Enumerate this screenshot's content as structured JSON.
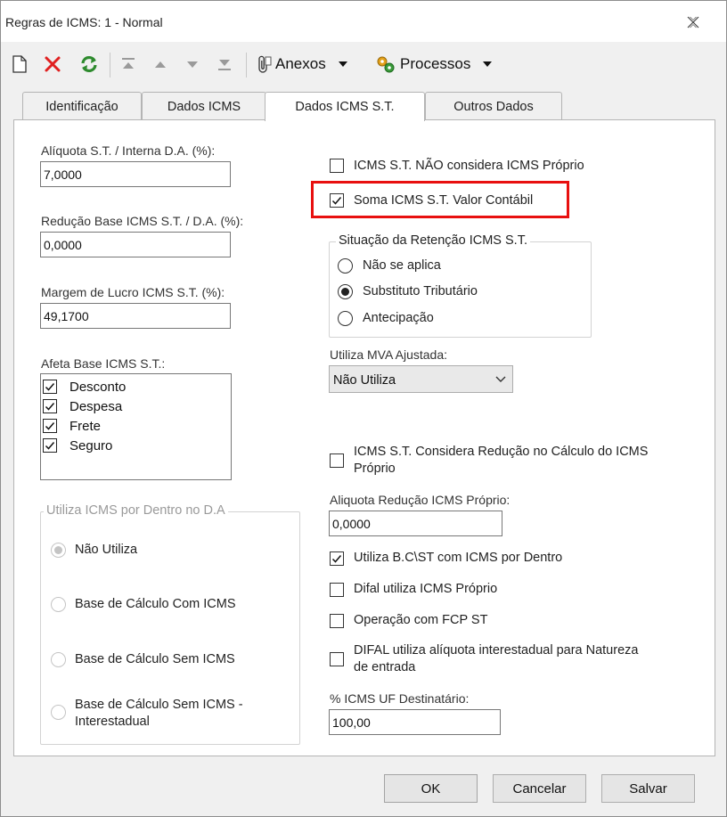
{
  "window": {
    "title": "Regras de ICMS: 1 - Normal"
  },
  "toolbar": {
    "icons": [
      "new-document-icon",
      "delete-x-icon",
      "refresh-icon",
      "move-first-icon",
      "move-up-icon",
      "move-down-icon",
      "move-last-icon",
      "paperclip-icon",
      "gears-icon"
    ],
    "anexos_label": "Anexos",
    "processos_label": "Processos"
  },
  "tabs": [
    {
      "label": "Identificação",
      "active": false
    },
    {
      "label": "Dados ICMS",
      "active": false
    },
    {
      "label": "Dados ICMS S.T.",
      "active": true
    },
    {
      "label": "Outros Dados",
      "active": false
    }
  ],
  "left": {
    "aliquota_label": "Alíquota S.T. / Interna D.A. (%):",
    "aliquota_value": "7,0000",
    "reducao_label": "Redução Base ICMS S.T. / D.A. (%):",
    "reducao_value": "0,0000",
    "margem_label": "Margem de Lucro ICMS S.T. (%):",
    "margem_value": "49,1700",
    "afeta_label": "Afeta Base ICMS S.T.:",
    "afeta_items": [
      {
        "label": "Desconto",
        "checked": true
      },
      {
        "label": "Despesa",
        "checked": true
      },
      {
        "label": "Frete",
        "checked": true
      },
      {
        "label": "Seguro",
        "checked": true
      }
    ],
    "icms_dentro_group": {
      "title": "Utiliza ICMS por Dentro no D.A",
      "options": [
        {
          "label": "Não Utiliza",
          "selected": true
        },
        {
          "label": "Base de Cálculo Com ICMS",
          "selected": false
        },
        {
          "label": "Base de Cálculo Sem ICMS",
          "selected": false
        },
        {
          "label": "Base de Cálculo Sem ICMS -",
          "label2": "Interestadual",
          "selected": false
        }
      ]
    }
  },
  "right": {
    "nao_considera_label": "ICMS S.T. NÃO considera ICMS Próprio",
    "nao_considera_checked": false,
    "soma_label": "Soma ICMS S.T. Valor Contábil",
    "soma_checked": true,
    "situacao_group": {
      "title": "Situação da Retenção ICMS S.T.",
      "options": [
        {
          "label": "Não se aplica",
          "selected": false
        },
        {
          "label": "Substituto Tributário",
          "selected": true
        },
        {
          "label": "Antecipação",
          "selected": false
        }
      ]
    },
    "mva_label": "Utiliza MVA Ajustada:",
    "mva_value": "Não Utiliza",
    "considera_reducao_label": "ICMS S.T. Considera Redução no Cálculo do ICMS",
    "considera_reducao_label2": "Próprio",
    "considera_reducao_checked": false,
    "aliquota_reducao_label": "Aliquota Redução ICMS Próprio:",
    "aliquota_reducao_value": "0,0000",
    "utiliza_bc_label": "Utiliza B.C\\ST com ICMS por Dentro",
    "utiliza_bc_checked": true,
    "difal_label": "Difal utiliza ICMS Próprio",
    "difal_checked": false,
    "fcp_label": "Operação com FCP ST",
    "fcp_checked": false,
    "difal_inter_label": "DIFAL utiliza alíquota interestadual para Natureza",
    "difal_inter_label2": "de entrada",
    "difal_inter_checked": false,
    "icms_uf_label": "% ICMS UF Destinatário:",
    "icms_uf_value": "100,00"
  },
  "buttons": {
    "ok": "OK",
    "cancel": "Cancelar",
    "save": "Salvar"
  },
  "colors": {
    "highlight": "#e8100f",
    "delete": "#e02020",
    "refresh": "#2e8b2e"
  }
}
